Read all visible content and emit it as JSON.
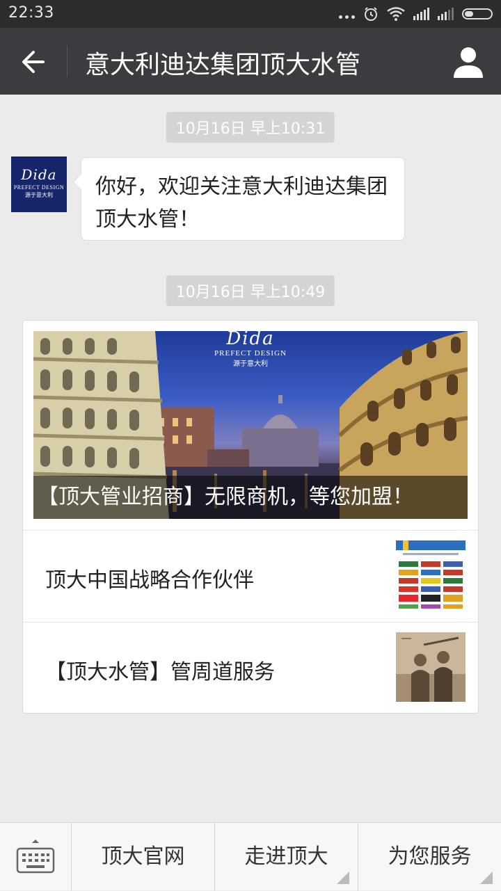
{
  "status_bar": {
    "time": "22:33"
  },
  "nav": {
    "title": "意大利迪达集团顶大水管"
  },
  "timestamps": [
    "10月16日 早上10:31",
    "10月16日 早上10:49"
  ],
  "avatar": {
    "brand": "Dida",
    "subtitle": "PREFECT DESIGN",
    "tagline": "源于意大利"
  },
  "message": {
    "text": "你好，欢迎关注意大利迪达集团顶大水管！"
  },
  "article_card": {
    "cover": {
      "brand": "Dida",
      "brand_subtitle": "PREFECT DESIGN",
      "brand_tagline": "源于意大利",
      "title": "【顶大管业招商】无限商机，等您加盟！"
    },
    "items": [
      {
        "title": "顶大中国战略合作伙伴"
      },
      {
        "title": "【顶大水管】管周道服务"
      }
    ]
  },
  "bottom_menu": {
    "items": [
      {
        "label": "顶大官网"
      },
      {
        "label": "走进顶大"
      },
      {
        "label": "为您服务"
      }
    ]
  }
}
